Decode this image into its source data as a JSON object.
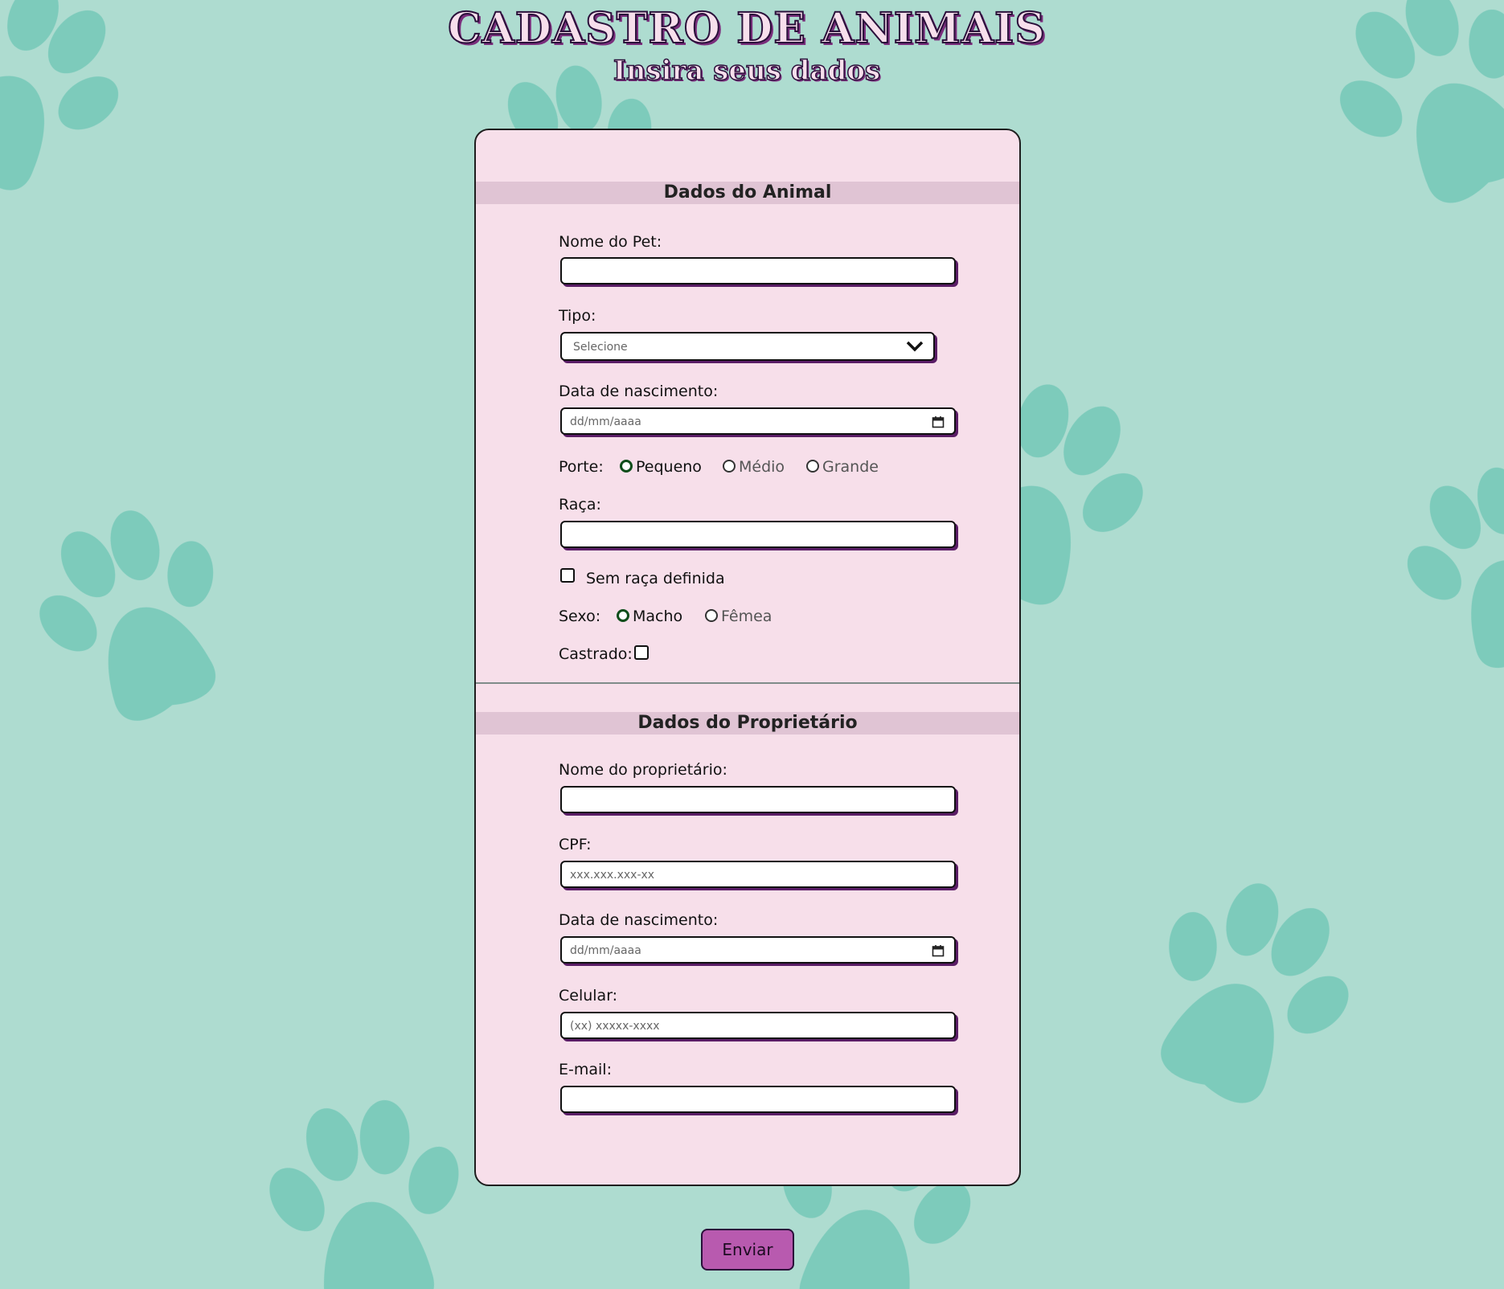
{
  "header": {
    "title": "CADASTRO DE ANIMAIS",
    "subtitle": "Insira seus dados"
  },
  "animal_section": {
    "title": "Dados do Animal",
    "pet_name": {
      "label": "Nome do Pet:",
      "value": ""
    },
    "type": {
      "label": "Tipo:",
      "selected": "Selecione"
    },
    "birth_date": {
      "label": "Data de nascimento:",
      "placeholder": "dd/mm/aaaa"
    },
    "size": {
      "label": "Porte:",
      "options": [
        "Pequeno",
        "Médio",
        "Grande"
      ],
      "selected": "Pequeno"
    },
    "breed": {
      "label": "Raça:",
      "value": ""
    },
    "no_breed": {
      "label": "Sem raça definida",
      "checked": false
    },
    "sex": {
      "label": "Sexo:",
      "options": [
        "Macho",
        "Fêmea"
      ],
      "selected": "Macho"
    },
    "neutered": {
      "label": "Castrado:",
      "checked": false
    }
  },
  "owner_section": {
    "title": "Dados do Proprietário",
    "owner_name": {
      "label": "Nome do proprietário:",
      "value": ""
    },
    "cpf": {
      "label": "CPF:",
      "placeholder": "xxx.xxx.xxx-xx"
    },
    "birth_date": {
      "label": "Data de nascimento:",
      "placeholder": "dd/mm/aaaa"
    },
    "phone": {
      "label": "Celular:",
      "placeholder": "(xx) xxxxx-xxxx"
    },
    "email": {
      "label": "E-mail:",
      "value": ""
    }
  },
  "submit": {
    "label": "Enviar"
  },
  "colors": {
    "background": "#aedcd0",
    "paw": "#74c8b8",
    "card": "#f7dfea",
    "section_header": "#e0c4d4",
    "button": "#b85aaf",
    "input_shadow": "#5a1d66",
    "radio_checked": "#0e4d1a"
  },
  "icons": [
    "paw-print-icon",
    "chevron-down-icon",
    "calendar-icon"
  ]
}
